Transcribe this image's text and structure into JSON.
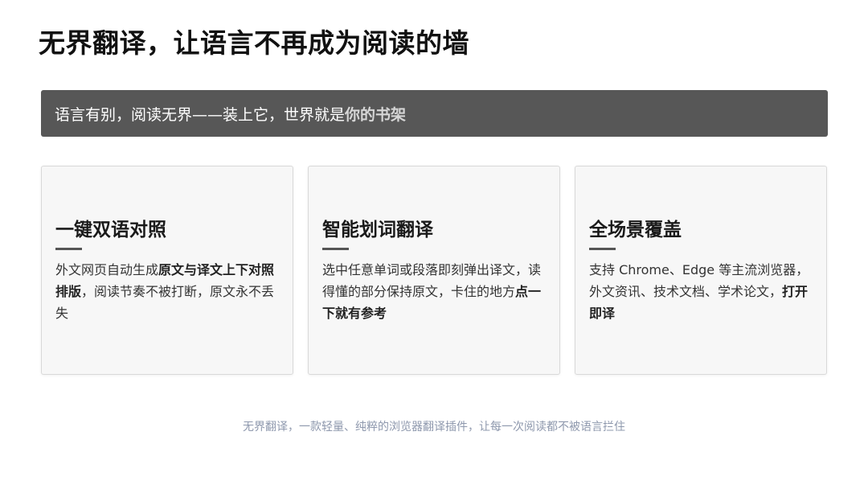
{
  "title": "无界翻译，让语言不再成为阅读的墙",
  "banner": {
    "text": "语言有别，阅读无界——装上它，世界就是",
    "emphasis": "你的书架"
  },
  "cards": [
    {
      "title": "一键双语对照",
      "desc_1": "外文网页自动生成",
      "desc_bold": "原文与译文上下对照排版",
      "desc_2": "，阅读节奏不被打断，原文永不丢失"
    },
    {
      "title": "智能划词翻译",
      "desc_1": "选中任意单词或段落即刻弹出译文，读得懂的部分保持原文，卡住的地方",
      "desc_bold": "点一下就有参考",
      "desc_2": ""
    },
    {
      "title": "全场景覆盖",
      "desc_1": "支持 Chrome、Edge 等主流浏览器，外文资讯、技术文档、学术论文，",
      "desc_bold": "打开即译",
      "desc_2": ""
    }
  ],
  "footer": "无界翻译，一款轻量、纯粹的浏览器翻译插件，让每一次阅读都不被语言拦住",
  "colors": {
    "banner_bg": "#575757",
    "card_bg": "#f7f7f7",
    "footer_text": "#8e98ad"
  }
}
